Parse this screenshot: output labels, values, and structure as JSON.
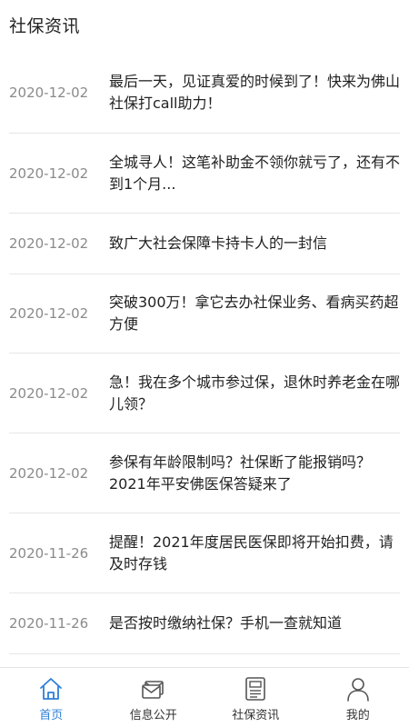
{
  "header": {
    "title": "社保资讯"
  },
  "news": [
    {
      "date": "2020-12-02",
      "title": "最后一天，见证真爱的时候到了！快来为佛山社保打call助力！"
    },
    {
      "date": "2020-12-02",
      "title": "全城寻人！这笔补助金不领你就亏了，还有不到1个月..."
    },
    {
      "date": "2020-12-02",
      "title": "致广大社会保障卡持卡人的一封信"
    },
    {
      "date": "2020-12-02",
      "title": "突破300万！拿它去办社保业务、看病买药超方便"
    },
    {
      "date": "2020-12-02",
      "title": "急！我在多个城市参过保，退休时养老金在哪儿领？"
    },
    {
      "date": "2020-12-02",
      "title": "参保有年龄限制吗？社保断了能报销吗？2021年平安佛医保答疑来了"
    },
    {
      "date": "2020-11-26",
      "title": "提醒！2021年度居民医保即将开始扣费，请及时存钱"
    },
    {
      "date": "2020-11-26",
      "title": "是否按时缴纳社保？手机一查就知道"
    }
  ],
  "bottom_nav": [
    {
      "label": "首页",
      "icon": "home-icon",
      "active": true
    },
    {
      "label": "信息公开",
      "icon": "mail-icon",
      "active": false
    },
    {
      "label": "社保资讯",
      "icon": "news-icon",
      "active": false
    },
    {
      "label": "我的",
      "icon": "user-icon",
      "active": false
    }
  ],
  "colors": {
    "accent": "#2f7fd8",
    "date": "#8a8a8a",
    "divider": "#e6e6e6"
  }
}
